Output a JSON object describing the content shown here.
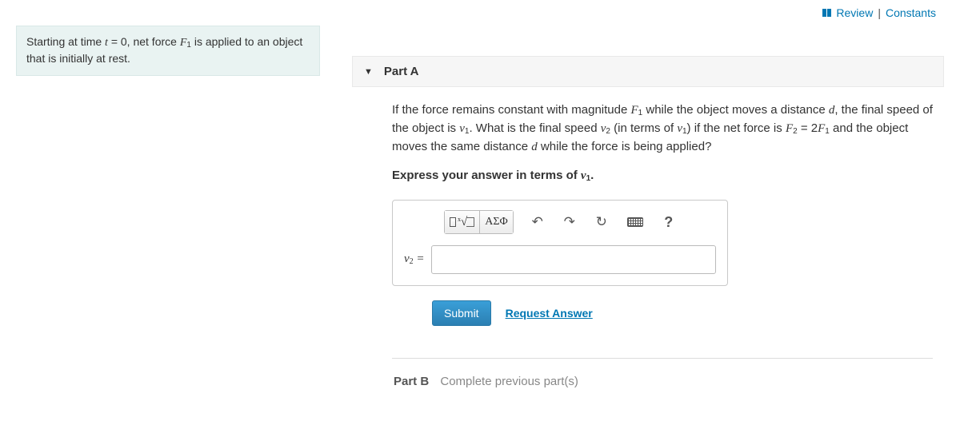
{
  "header": {
    "review": "Review",
    "constants": "Constants"
  },
  "problem_statement_html": "Starting at time <span class='mi'>t</span> = 0, net force <span class='mi'>F</span><span class='ms'>1</span> is applied to an object that is initially at rest.",
  "partA": {
    "label": "Part A",
    "body_html": "If the force remains constant with magnitude <span class='mi'>F</span><span class='ms'>1</span> while the object moves a distance <span class='mi'>d</span>, the final speed of the object is <span class='mi'>v</span><span class='ms'>1</span>. What is the final speed <span class='mi'>v</span><span class='ms'>2</span> (in terms of <span class='mi'>v</span><span class='ms'>1</span>) if the net force is <span class='mi'>F</span><span class='ms'>2</span> = 2<span class='mi'>F</span><span class='ms'>1</span> and the object moves the same distance <span class='mi'>d</span> while the force is being applied?",
    "instruction_html": "Express your answer in terms of <span class='mi'>v</span><span class='ms'>1</span>.",
    "var_label_html": "<span class='mi'>v</span><span class='sub'>2</span> =",
    "answer_value": "",
    "submit": "Submit",
    "request": "Request Answer",
    "toolbar": {
      "greek": "ΑΣΦ",
      "help": "?"
    }
  },
  "partB": {
    "label": "Part B",
    "status": "Complete previous part(s)"
  }
}
